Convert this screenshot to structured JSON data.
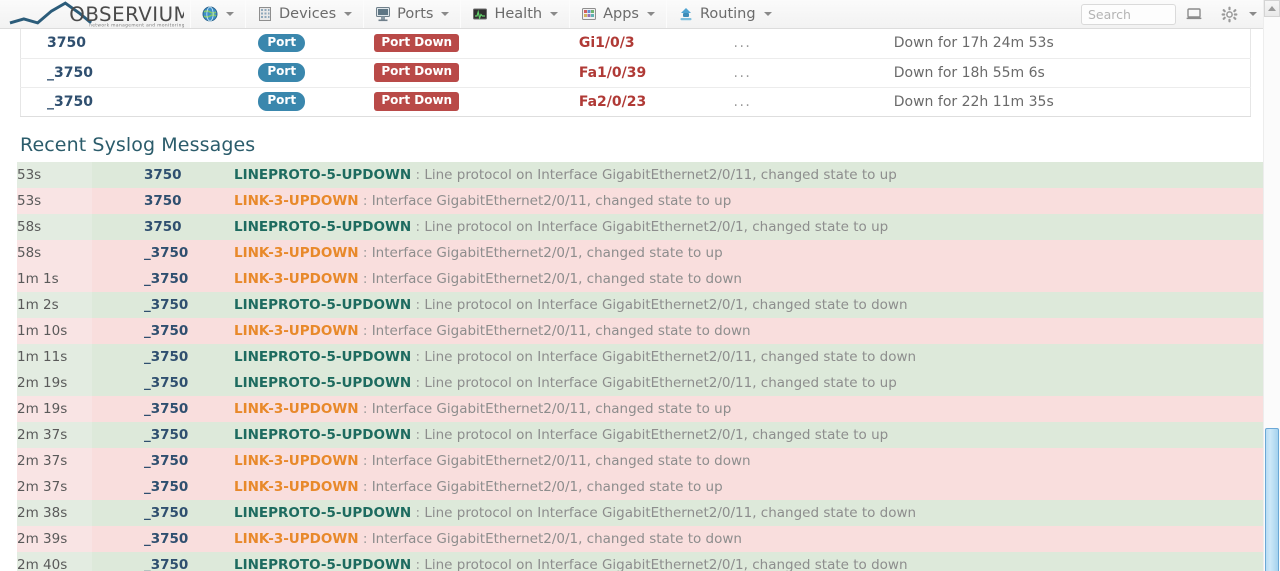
{
  "navbar": {
    "brand": {
      "name": "OBSERVIUM",
      "tagline": "network management and monitoring"
    },
    "globe_item": {
      "icon": "globe-icon",
      "label": ""
    },
    "items": [
      {
        "label": "Devices",
        "icon": "devices-icon"
      },
      {
        "label": "Ports",
        "icon": "ports-icon"
      },
      {
        "label": "Health",
        "icon": "health-icon"
      },
      {
        "label": "Apps",
        "icon": "apps-icon"
      },
      {
        "label": "Routing",
        "icon": "routing-icon"
      }
    ],
    "search": {
      "placeholder": "Search",
      "value": ""
    },
    "display_icon": "laptop-icon",
    "settings_icon": "gear-icon"
  },
  "ports_table": {
    "rows": [
      {
        "device": "3750",
        "type": "Port",
        "state": "Port Down",
        "interface": "Gi1/0/3",
        "dots": "...",
        "duration": "Down for 17h 24m 53s"
      },
      {
        "device": "_3750",
        "type": "Port",
        "state": "Port Down",
        "interface": "Fa1/0/39",
        "dots": "...",
        "duration": "Down for 18h 55m 6s"
      },
      {
        "device": "_3750",
        "type": "Port",
        "state": "Port Down",
        "interface": "Fa2/0/23",
        "dots": "...",
        "duration": "Down for 22h 11m 35s"
      }
    ]
  },
  "syslog": {
    "title": "Recent Syslog Messages",
    "rows": [
      {
        "time": "53s",
        "device": "3750",
        "tag": "LINEPROTO-5-UPDOWN",
        "severity": "ok",
        "message": "Line protocol on Interface GigabitEthernet2/0/11, changed state to up"
      },
      {
        "time": "53s",
        "device": "3750",
        "tag": "LINK-3-UPDOWN",
        "severity": "err",
        "message": "Interface GigabitEthernet2/0/11, changed state to up"
      },
      {
        "time": "58s",
        "device": "3750",
        "tag": "LINEPROTO-5-UPDOWN",
        "severity": "ok",
        "message": "Line protocol on Interface GigabitEthernet2/0/1, changed state to up"
      },
      {
        "time": "58s",
        "device": "_3750",
        "tag": "LINK-3-UPDOWN",
        "severity": "err",
        "message": "Interface GigabitEthernet2/0/1, changed state to up"
      },
      {
        "time": "1m 1s",
        "device": "_3750",
        "tag": "LINK-3-UPDOWN",
        "severity": "err",
        "message": "Interface GigabitEthernet2/0/1, changed state to down"
      },
      {
        "time": "1m 2s",
        "device": "_3750",
        "tag": "LINEPROTO-5-UPDOWN",
        "severity": "ok",
        "message": "Line protocol on Interface GigabitEthernet2/0/1, changed state to down"
      },
      {
        "time": "1m 10s",
        "device": "_3750",
        "tag": "LINK-3-UPDOWN",
        "severity": "err",
        "message": "Interface GigabitEthernet2/0/11, changed state to down"
      },
      {
        "time": "1m 11s",
        "device": "_3750",
        "tag": "LINEPROTO-5-UPDOWN",
        "severity": "ok",
        "message": "Line protocol on Interface GigabitEthernet2/0/11, changed state to down"
      },
      {
        "time": "2m 19s",
        "device": "_3750",
        "tag": "LINEPROTO-5-UPDOWN",
        "severity": "ok",
        "message": "Line protocol on Interface GigabitEthernet2/0/11, changed state to up"
      },
      {
        "time": "2m 19s",
        "device": "_3750",
        "tag": "LINK-3-UPDOWN",
        "severity": "err",
        "message": "Interface GigabitEthernet2/0/11, changed state to up"
      },
      {
        "time": "2m 37s",
        "device": "_3750",
        "tag": "LINEPROTO-5-UPDOWN",
        "severity": "ok",
        "message": "Line protocol on Interface GigabitEthernet2/0/1, changed state to up"
      },
      {
        "time": "2m 37s",
        "device": "_3750",
        "tag": "LINK-3-UPDOWN",
        "severity": "err",
        "message": "Interface GigabitEthernet2/0/11, changed state to down"
      },
      {
        "time": "2m 37s",
        "device": "_3750",
        "tag": "LINK-3-UPDOWN",
        "severity": "err",
        "message": "Interface GigabitEthernet2/0/1, changed state to up"
      },
      {
        "time": "2m 38s",
        "device": "_3750",
        "tag": "LINEPROTO-5-UPDOWN",
        "severity": "ok",
        "message": "Line protocol on Interface GigabitEthernet2/0/11, changed state to down"
      },
      {
        "time": "2m 39s",
        "device": "_3750",
        "tag": "LINK-3-UPDOWN",
        "severity": "err",
        "message": "Interface GigabitEthernet2/0/1, changed state to down"
      },
      {
        "time": "2m 40s",
        "device": "_3750",
        "tag": "LINEPROTO-5-UPDOWN",
        "severity": "ok",
        "message": "Line protocol on Interface GigabitEthernet2/0/1, changed state to down"
      }
    ]
  },
  "colors": {
    "brand_dark": "#2f4f6f",
    "label_port": "#3a87ad",
    "label_down": "#b94a48",
    "iface_link": "#b03a36",
    "section_title": "#2b5c6b",
    "tag_ok": "#1d6b5f",
    "tag_err": "#e8892a",
    "row_ok_bg": "#dde9da",
    "row_err_bg": "#f9dedd",
    "scrollbar_thumb": "#a5d2ee"
  }
}
